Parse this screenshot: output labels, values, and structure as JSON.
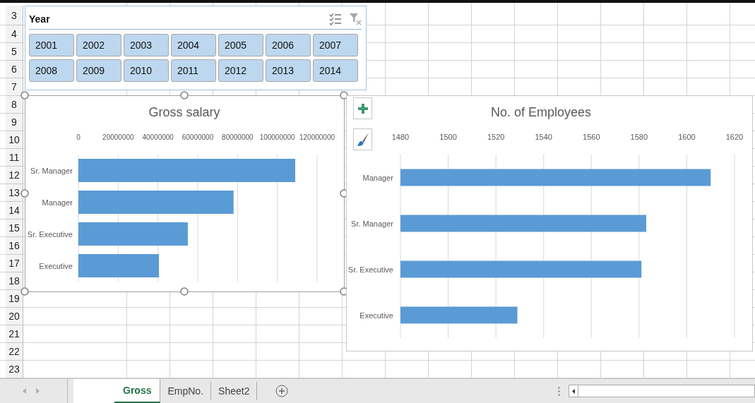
{
  "row_numbers": [
    "3",
    "4",
    "5",
    "6",
    "7",
    "8",
    "9",
    "10",
    "11",
    "12",
    "13",
    "14",
    "15",
    "16",
    "17",
    "18",
    "19",
    "20",
    "21",
    "22",
    "23"
  ],
  "slicer": {
    "title": "Year",
    "items": [
      {
        "label": "2001",
        "selected": true
      },
      {
        "label": "2002",
        "selected": true
      },
      {
        "label": "2003",
        "selected": true
      },
      {
        "label": "2004",
        "selected": true
      },
      {
        "label": "2005",
        "selected": true
      },
      {
        "label": "2006",
        "selected": true
      },
      {
        "label": "2007",
        "selected": true
      },
      {
        "label": "2008",
        "selected": true
      },
      {
        "label": "2009",
        "selected": true
      },
      {
        "label": "2010",
        "selected": true
      },
      {
        "label": "2011",
        "selected": true
      },
      {
        "label": "2012",
        "selected": true
      },
      {
        "label": "2013",
        "selected": true
      },
      {
        "label": "2014",
        "selected": true
      }
    ]
  },
  "charts": [
    {
      "selected": true,
      "chart_data": {
        "type": "bar",
        "orientation": "horizontal",
        "title": "Gross salary",
        "categories": [
          "Sr. Manager",
          "Manager",
          "Sr. Executive",
          "Executive"
        ],
        "series": [
          {
            "color": "#5b9bd5",
            "values": [
              109000000,
              78000000,
              55000000,
              40500000
            ]
          }
        ],
        "xlim": [
          0,
          120000000
        ],
        "grid": true,
        "xticks": [
          0,
          20000000,
          40000000,
          60000000,
          80000000,
          100000000,
          120000000
        ]
      }
    },
    {
      "selected": false,
      "chart_data": {
        "type": "bar",
        "orientation": "horizontal",
        "title": "No. of Employees",
        "categories": [
          "Manager",
          "Sr. Manager",
          "Sr. Executive",
          "Executive"
        ],
        "series": [
          {
            "color": "#5b9bd5",
            "values": [
              1610,
              1583,
              1581,
              1529
            ]
          }
        ],
        "xlim": [
          1480,
          1620
        ],
        "grid": true,
        "xticks": [
          1480,
          1500,
          1520,
          1540,
          1560,
          1580,
          1600,
          1620
        ]
      }
    }
  ],
  "sheet_tabs": [
    {
      "label": "Gross",
      "selected": true
    },
    {
      "label": "EmpNo.",
      "selected": false
    },
    {
      "label": "Sheet2",
      "selected": false
    }
  ]
}
